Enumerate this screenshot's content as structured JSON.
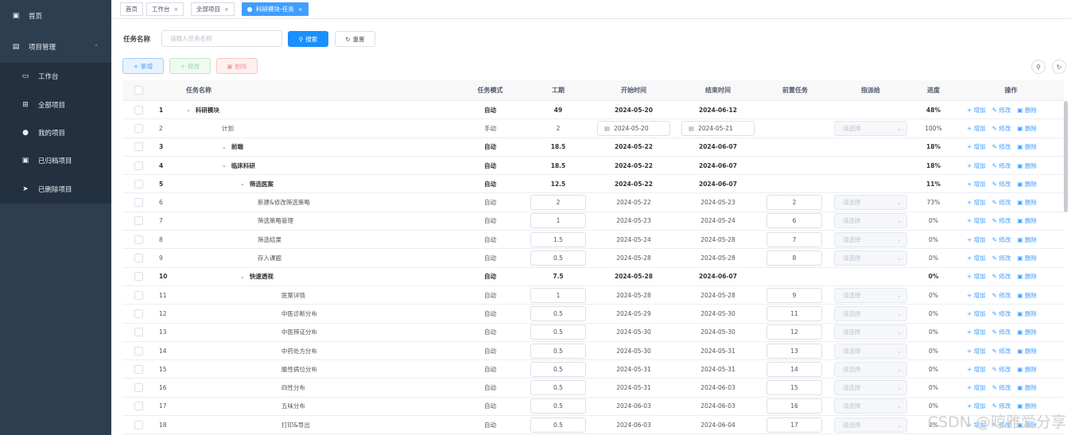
{
  "sidebar": {
    "home": "首页",
    "project_mgmt": "项目管理",
    "items": [
      {
        "label": "工作台",
        "icon": "monitor-icon"
      },
      {
        "label": "全部项目",
        "icon": "grid-icon"
      },
      {
        "label": "我的项目",
        "icon": "user-icon"
      },
      {
        "label": "已归档项目",
        "icon": "lock-icon"
      },
      {
        "label": "已删除项目",
        "icon": "send-icon"
      }
    ]
  },
  "tabs": [
    "首页",
    "工作台",
    "全部项目",
    "科研模块-任务"
  ],
  "search": {
    "label": "任务名称",
    "placeholder": "请输入任务名称",
    "search_btn": "搜索",
    "reset_btn": "重置"
  },
  "toolbar": {
    "add": "新增",
    "edit": "修改",
    "delete": "删除"
  },
  "columns": [
    "任务名称",
    "任务模式",
    "工期",
    "开始时间",
    "结束时间",
    "前置任务",
    "指派给",
    "进度",
    "操作"
  ],
  "ops": {
    "add": "增加",
    "edit": "修改",
    "delete": "删除"
  },
  "select_placeholder": "请选择",
  "rows": [
    {
      "n": "1",
      "name": "科研模块",
      "mode": "自动",
      "dur": "49",
      "start": "2024-05-20",
      "end": "2024-06-12",
      "pre": "",
      "prog": "48%",
      "bold": true,
      "level": 0,
      "expand": true
    },
    {
      "n": "2",
      "name": "计划",
      "mode": "手动",
      "dur": "2",
      "start": "2024-05-20",
      "end": "2024-05-21",
      "pre": "",
      "prog": "100%",
      "bold": false,
      "level": 1,
      "manual": true
    },
    {
      "n": "3",
      "name": "前端",
      "mode": "自动",
      "dur": "18.5",
      "start": "2024-05-22",
      "end": "2024-06-07",
      "pre": "",
      "prog": "18%",
      "bold": true,
      "level": 1,
      "expand": true
    },
    {
      "n": "4",
      "name": "临床科研",
      "mode": "自动",
      "dur": "18.5",
      "start": "2024-05-22",
      "end": "2024-06-07",
      "pre": "",
      "prog": "18%",
      "bold": true,
      "level": 2,
      "expand": true
    },
    {
      "n": "5",
      "name": "筛选医案",
      "mode": "自动",
      "dur": "12.5",
      "start": "2024-05-22",
      "end": "2024-06-07",
      "pre": "",
      "prog": "11%",
      "bold": true,
      "level": 3,
      "expand": true
    },
    {
      "n": "6",
      "name": "新建&修改筛选策略",
      "mode": "自动",
      "dur": "2",
      "start": "2024-05-22",
      "end": "2024-05-23",
      "pre": "2",
      "prog": "73%",
      "bold": false,
      "level": 4
    },
    {
      "n": "7",
      "name": "筛选策略管理",
      "mode": "自动",
      "dur": "1",
      "start": "2024-05-23",
      "end": "2024-05-24",
      "pre": "6",
      "prog": "0%",
      "bold": false,
      "level": 4
    },
    {
      "n": "8",
      "name": "筛选结果",
      "mode": "自动",
      "dur": "1.5",
      "start": "2024-05-24",
      "end": "2024-05-28",
      "pre": "7",
      "prog": "0%",
      "bold": false,
      "level": 4
    },
    {
      "n": "9",
      "name": "存入课题",
      "mode": "自动",
      "dur": "0.5",
      "start": "2024-05-28",
      "end": "2024-05-28",
      "pre": "8",
      "prog": "0%",
      "bold": false,
      "level": 4
    },
    {
      "n": "10",
      "name": "快速透视",
      "mode": "自动",
      "dur": "7.5",
      "start": "2024-05-28",
      "end": "2024-06-07",
      "pre": "",
      "prog": "0%",
      "bold": true,
      "level": 3,
      "expand": true
    },
    {
      "n": "11",
      "name": "医案详情",
      "mode": "自动",
      "dur": "1",
      "start": "2024-05-28",
      "end": "2024-05-28",
      "pre": "9",
      "prog": "0%",
      "bold": false,
      "level": 5
    },
    {
      "n": "12",
      "name": "中医诊断分布",
      "mode": "自动",
      "dur": "0.5",
      "start": "2024-05-29",
      "end": "2024-05-30",
      "pre": "11",
      "prog": "0%",
      "bold": false,
      "level": 5
    },
    {
      "n": "13",
      "name": "中医辨证分布",
      "mode": "自动",
      "dur": "0.5",
      "start": "2024-05-30",
      "end": "2024-05-30",
      "pre": "12",
      "prog": "0%",
      "bold": false,
      "level": 5
    },
    {
      "n": "14",
      "name": "中药处方分布",
      "mode": "自动",
      "dur": "0.5",
      "start": "2024-05-30",
      "end": "2024-05-31",
      "pre": "13",
      "prog": "0%",
      "bold": false,
      "level": 5
    },
    {
      "n": "15",
      "name": "腧性病位分布",
      "mode": "自动",
      "dur": "0.5",
      "start": "2024-05-31",
      "end": "2024-05-31",
      "pre": "14",
      "prog": "0%",
      "bold": false,
      "level": 5
    },
    {
      "n": "16",
      "name": "四性分布",
      "mode": "自动",
      "dur": "0.5",
      "start": "2024-05-31",
      "end": "2024-06-03",
      "pre": "15",
      "prog": "0%",
      "bold": false,
      "level": 5
    },
    {
      "n": "17",
      "name": "五味分布",
      "mode": "自动",
      "dur": "0.5",
      "start": "2024-06-03",
      "end": "2024-06-03",
      "pre": "16",
      "prog": "0%",
      "bold": false,
      "level": 5
    },
    {
      "n": "18",
      "name": "打印&导出",
      "mode": "自动",
      "dur": "0.5",
      "start": "2024-06-03",
      "end": "2024-06-04",
      "pre": "17",
      "prog": "0%",
      "bold": false,
      "level": 5
    }
  ],
  "watermark": "CSDN @晾雅爱分享"
}
